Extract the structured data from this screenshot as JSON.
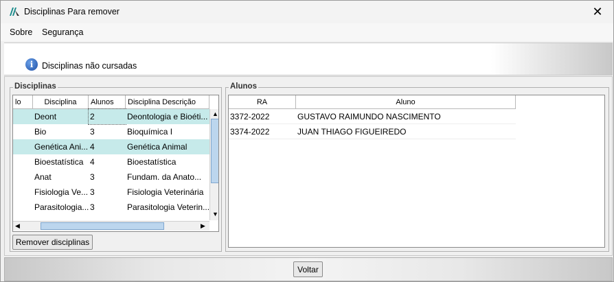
{
  "window": {
    "title": "Disciplinas Para remover"
  },
  "menu": {
    "items": [
      "Sobre",
      "Segurança"
    ]
  },
  "header": {
    "text": "Disciplinas não cursadas"
  },
  "disciplinas": {
    "legend": "Disciplinas",
    "columns": [
      "lo",
      "Disciplina",
      "Alunos",
      "Disciplina Descrição"
    ],
    "rows": [
      {
        "disciplina": "Deont",
        "alunos": "2",
        "descricao": "Deontologia e Bioéti...",
        "selected": true
      },
      {
        "disciplina": "Bio",
        "alunos": "3",
        "descricao": "Bioquímica I",
        "selected": false
      },
      {
        "disciplina": "Genética Ani...",
        "alunos": "4",
        "descricao": "Genética Animal",
        "selected": true
      },
      {
        "disciplina": "Bioestatística",
        "alunos": "4",
        "descricao": "Bioestatística",
        "selected": false
      },
      {
        "disciplina": "Anat",
        "alunos": "3",
        "descricao": "Fundam. da Anato...",
        "selected": false
      },
      {
        "disciplina": "Fisiologia Ve...",
        "alunos": "3",
        "descricao": "Fisiologia Veterinária",
        "selected": false
      },
      {
        "disciplina": "Parasitologia...",
        "alunos": "3",
        "descricao": "Parasitologia Veterin...",
        "selected": false
      }
    ],
    "remove_button": "Remover disciplinas"
  },
  "alunos": {
    "legend": "Alunos",
    "columns": [
      "RA",
      "Aluno"
    ],
    "rows": [
      {
        "ra": "3372-2022",
        "aluno": "GUSTAVO RAIMUNDO NASCIMENTO"
      },
      {
        "ra": "3374-2022",
        "aluno": "JUAN THIAGO FIGUEIREDO"
      }
    ]
  },
  "footer": {
    "voltar_button": "Voltar"
  },
  "colors": {
    "selected_row": "#c6eaea",
    "scroll_thumb": "#bcd6ee",
    "info_blue": "#1e4fa5"
  }
}
